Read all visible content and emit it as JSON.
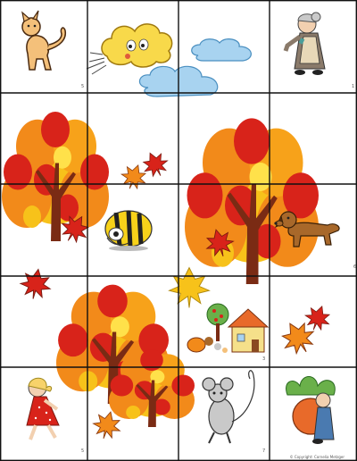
{
  "board": {
    "rows": 5,
    "cols": 4,
    "background": "#ffffff",
    "grid_color": "#111111"
  },
  "cell_numbers": [
    "5",
    "1",
    "6",
    "3",
    "5",
    "7"
  ],
  "copyright": "© Copyright: Cornelia Metzger",
  "pictures": {
    "cat": "cat-illustration",
    "wind_cloud": "blowing-cloud-illustration",
    "clouds": "clouds-illustration",
    "grandmother": "grandmother-illustration",
    "trees": "autumn-tree-illustration",
    "bee_bot": "bee-bot-robot-illustration",
    "dog": "dog-illustration",
    "house": "house-with-animals-illustration",
    "girl": "girl-illustration",
    "mouse": "mouse-illustration",
    "turnip": "giant-turnip-illustration",
    "leaves": "autumn-leaf-illustration"
  },
  "colors": {
    "leaf_orange": "#f28a1a",
    "leaf_red": "#d8231a",
    "leaf_yellow": "#f7c21a",
    "trunk": "#7a2b14",
    "cloud_blue": "#a8d3f0",
    "sun_cloud": "#f8d94a"
  }
}
